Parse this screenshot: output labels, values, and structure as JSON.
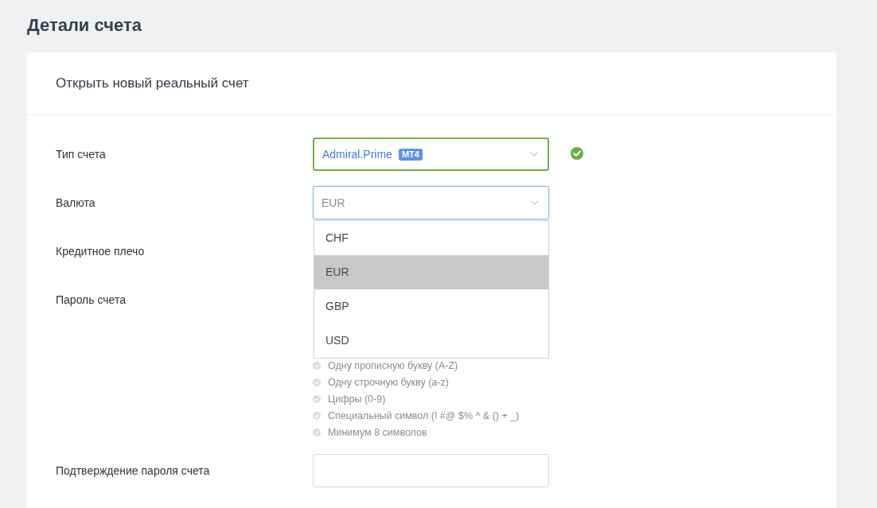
{
  "page": {
    "title": "Детали счета"
  },
  "card": {
    "title": "Открыть новый реальный счет"
  },
  "fields": [
    {
      "kind": "select",
      "label": "Тип счета",
      "value": "Admiral.Prime",
      "badge": "MT4",
      "valid": true
    },
    {
      "kind": "select",
      "label": "Валюта",
      "value": "EUR",
      "focused": true,
      "expanded": true,
      "options": [
        {
          "label": "CHF",
          "selected": false
        },
        {
          "label": "EUR",
          "selected": true
        },
        {
          "label": "GBP",
          "selected": false
        },
        {
          "label": "USD",
          "selected": false
        }
      ]
    },
    {
      "kind": "covered",
      "label": "Кредитное плечо"
    },
    {
      "kind": "password",
      "label": "Пароль счета",
      "requirements": [
        {
          "label": "Одну прописную букву (A-Z)",
          "met": false
        },
        {
          "label": "Одну строчную букву (a-z)",
          "met": false
        },
        {
          "label": "Цифры (0-9)",
          "met": false
        },
        {
          "label": "Специальный символ (! #@ $% ^ & () + _)",
          "met": false
        },
        {
          "label": "Минимум 8 символов",
          "met": false
        }
      ]
    },
    {
      "kind": "input",
      "label": "Подтверждение пароля счета"
    }
  ]
}
